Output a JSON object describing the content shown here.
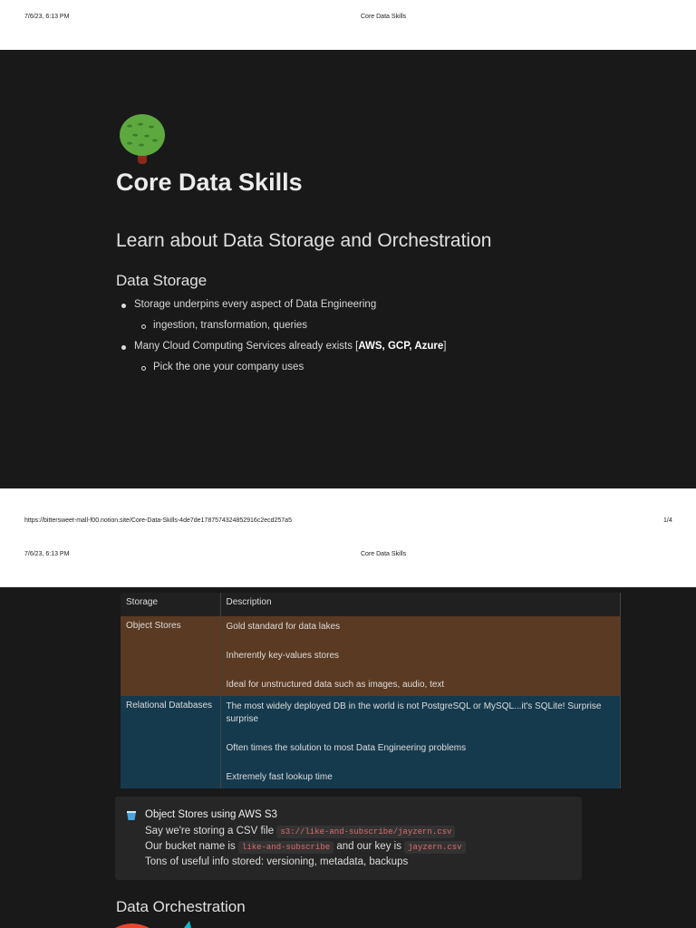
{
  "print": {
    "date": "7/6/23, 6:13 PM",
    "title": "Core Data Skills",
    "url": "https://bittersweet-mall-f00.notion.site/Core-Data-Skills-4de7de1787574324852916c2ecd257a5",
    "page": "1/4"
  },
  "page": {
    "title": "Core Data Skills",
    "icon": "tree-icon",
    "subtitle": "Learn about Data Storage and Orchestration",
    "section1": "Data Storage",
    "bullets": [
      {
        "text": "Storage underpins every aspect of Data Engineering",
        "sub": "ingestion, transformation, queries"
      },
      {
        "text": "Many Cloud Computing Services already exists [",
        "bold": "AWS, GCP, Azure",
        "end": "]",
        "sub": "Pick the one your company uses"
      }
    ],
    "table": {
      "headers": [
        "Storage",
        "Description"
      ],
      "rows": [
        {
          "storage": "Object Stores",
          "color": "#5a3a22",
          "desc": [
            "Gold standard for data lakes",
            "Inherently key-values stores",
            "Ideal for unstructured data such as images, audio, text"
          ]
        },
        {
          "storage": "Relational Databases",
          "color": "#153a4e",
          "desc": [
            "The most widely deployed DB in the world is not PostgreSQL or MySQL...it's SQLite! Surprise surprise",
            "Often times the solution to most Data Engineering problems",
            "Extremely fast lookup time"
          ]
        }
      ]
    },
    "callout": {
      "title": "Object Stores using AWS S3",
      "l1": "Say we're storing a CSV file",
      "c1": "s3://like-and-subscribe/jayzern.csv",
      "l2a": "Our bucket name is",
      "c2": "like-and-subscribe",
      "l2b": "and our key is",
      "c3": "jayzern.csv",
      "l3": "Tons of useful info stored: versioning, metadata, backups"
    },
    "section2": "Data Orchestration"
  }
}
